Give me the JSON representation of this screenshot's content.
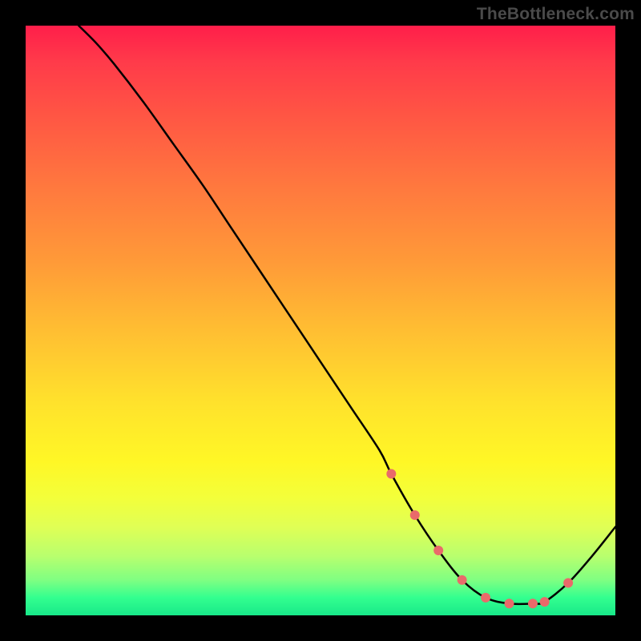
{
  "attribution": "TheBottleneck.com",
  "chart_data": {
    "type": "line",
    "title": "",
    "xlabel": "",
    "ylabel": "",
    "xlim": [
      0,
      100
    ],
    "ylim": [
      0,
      100
    ],
    "series": [
      {
        "name": "curve",
        "x": [
          9,
          12,
          15,
          20,
          25,
          30,
          35,
          40,
          45,
          50,
          55,
          60,
          62,
          66,
          70,
          74,
          78,
          82,
          86,
          88,
          92,
          96,
          100
        ],
        "values": [
          100,
          97,
          93.5,
          87,
          80,
          73,
          65.5,
          58,
          50.5,
          43,
          35.5,
          28,
          24,
          17,
          11,
          6,
          3,
          2,
          2,
          2.3,
          5.5,
          10,
          15
        ]
      }
    ],
    "markers": {
      "name": "dots",
      "color": "#e96a6a",
      "x": [
        62,
        66,
        70,
        74,
        78,
        82,
        86,
        88,
        92
      ],
      "values": [
        24,
        17,
        11,
        6,
        3,
        2,
        2,
        2.3,
        5.5
      ]
    },
    "colors": {
      "curve": "#000000",
      "markers": "#e96a6a",
      "gradient_top": "#ff1e4a",
      "gradient_bottom": "#18e889",
      "frame": "#000000"
    }
  }
}
